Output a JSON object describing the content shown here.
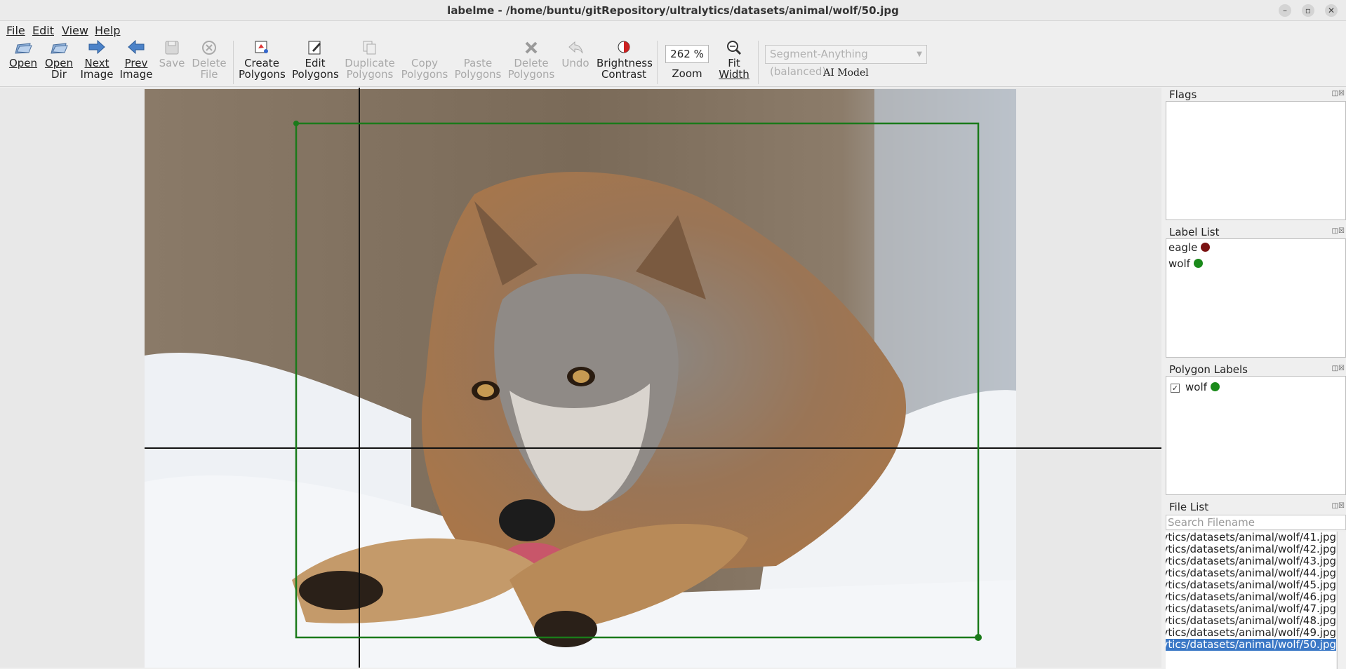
{
  "window": {
    "title": "labelme - /home/buntu/gitRepository/ultralytics/datasets/animal/wolf/50.jpg"
  },
  "menu": {
    "file": "File",
    "edit": "Edit",
    "view": "View",
    "help": "Help"
  },
  "toolbar": {
    "open": "Open",
    "open_dir_1": "Open",
    "open_dir_2": "Dir",
    "next_1": "Next",
    "next_2": "Image",
    "prev_1": "Prev",
    "prev_2": "Image",
    "save": "Save",
    "delete_file_1": "Delete",
    "delete_file_2": "File",
    "create_1": "Create",
    "create_2": "Polygons",
    "edit_1": "Edit",
    "edit_2": "Polygons",
    "dup_1": "Duplicate",
    "dup_2": "Polygons",
    "copy_1": "Copy",
    "copy_2": "Polygons",
    "paste_1": "Paste",
    "paste_2": "Polygons",
    "delpoly_1": "Delete",
    "delpoly_2": "Polygons",
    "undo": "Undo",
    "bright_1": "Brightness",
    "bright_2": "Contrast",
    "zoom_value": "262 %",
    "zoom_label": "Zoom",
    "fit_1": "Fit",
    "fit_2": "Width",
    "ai_model_value": "Segment-Anything (balanced)",
    "ai_model_label": "AI Model"
  },
  "panels": {
    "flags": {
      "title": "Flags"
    },
    "label_list": {
      "title": "Label List",
      "items": [
        {
          "name": "eagle",
          "color": "#7a1212"
        },
        {
          "name": "wolf",
          "color": "#1a8a1a"
        }
      ]
    },
    "polygon_labels": {
      "title": "Polygon Labels",
      "items": [
        {
          "name": "wolf",
          "color": "#1a8a1a",
          "checked": true
        }
      ]
    },
    "file_list": {
      "title": "File List",
      "search_placeholder": "Search Filename",
      "files": [
        "ytics/datasets/animal/wolf/41.jpg",
        "ytics/datasets/animal/wolf/42.jpg",
        "ytics/datasets/animal/wolf/43.jpg",
        "ytics/datasets/animal/wolf/44.jpg",
        "ytics/datasets/animal/wolf/45.jpg",
        "ytics/datasets/animal/wolf/46.jpg",
        "ytics/datasets/animal/wolf/47.jpg",
        "ytics/datasets/animal/wolf/48.jpg",
        "ytics/datasets/animal/wolf/49.jpg",
        "ytics/datasets/animal/wolf/50.jpg"
      ],
      "selected_index": 9
    }
  },
  "annotation": {
    "label": "wolf",
    "color": "#1a7a1a"
  }
}
